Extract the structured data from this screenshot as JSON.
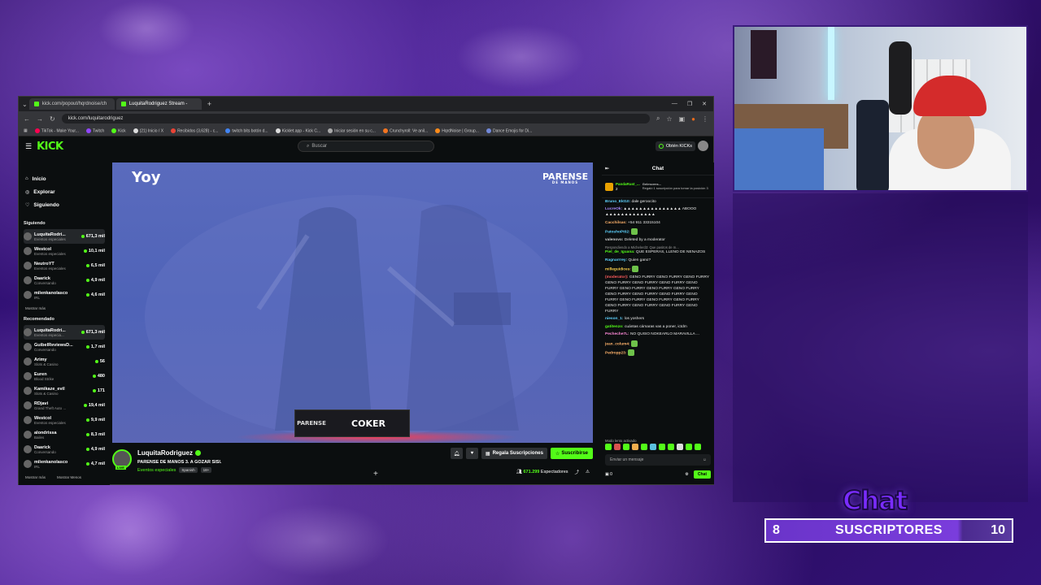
{
  "browser": {
    "tabs": [
      {
        "label": "kick.com/popout/hqrdnoise/ch"
      },
      {
        "label": "LuquitaRodriguez Stream -"
      }
    ],
    "url": "kick.com/luquitarodriguez",
    "bookmarks": [
      "TikTok - Make Your...",
      "Twitch",
      "Kick",
      "(21) Inicio / X",
      "Recibidos (3,628) - c...",
      "twitch bits botón d...",
      "Kicklet.app - Kick C...",
      "Iniciar sesión en su c...",
      "Crunchyroll: Ve anil...",
      "HqrdNoise | Group...",
      "Dance Emojis for Di..."
    ]
  },
  "kick": {
    "logo": "KICK",
    "search_placeholder": "Buscar",
    "kicks_button": "Obtén KICKs",
    "nav": [
      {
        "icon": "home-icon",
        "label": "Inicio"
      },
      {
        "icon": "compass-icon",
        "label": "Explorar"
      },
      {
        "icon": "heart-icon",
        "label": "Siguiendo"
      }
    ],
    "following_title": "Siguiendo",
    "following": [
      {
        "name": "LuquitaRodri...",
        "category": "Eventos especiales",
        "viewers": "671,3 mil"
      },
      {
        "name": "Westcol",
        "category": "Eventos especiales",
        "viewers": "10,1 mil"
      },
      {
        "name": "NeutroYT",
        "category": "Eventos especiales",
        "viewers": "6,5 mil"
      },
      {
        "name": "Daarick",
        "category": "Conversando",
        "viewers": "4,9 mil"
      },
      {
        "name": "milenkanolasco",
        "category": "IRL",
        "viewers": "4,6 mil"
      }
    ],
    "show_more": "Mostrar más",
    "recommended_title": "Recomendado",
    "recommended": [
      {
        "name": "LuquitaRodri...",
        "category": "Eventos especia...",
        "viewers": "671,3 mil"
      },
      {
        "name": "GuibelReviewsD...",
        "category": "Conversando",
        "viewers": "1,7 mil"
      },
      {
        "name": "Arimy",
        "category": "Slots & Casino",
        "viewers": "56"
      },
      {
        "name": "Euren",
        "category": "Blood Strike",
        "viewers": "480"
      },
      {
        "name": "Kamikaze_evil",
        "category": "Slots & Casino",
        "viewers": "171"
      },
      {
        "name": "RDjavi",
        "category": "Grand Theft Auto ...",
        "viewers": "19,4 mil"
      },
      {
        "name": "Westcol",
        "category": "Eventos especiales",
        "viewers": "9,9 mil"
      },
      {
        "name": "alondrissa",
        "category": "Bailes",
        "viewers": "8,3 mil"
      },
      {
        "name": "Daarick",
        "category": "Conversando",
        "viewers": "4,9 mil"
      },
      {
        "name": "milenkanolasco",
        "category": "IRL",
        "viewers": "4,7 mil"
      }
    ],
    "show_more_2": "Mostrar más",
    "show_less": "Mostrar Menos"
  },
  "player": {
    "watermark": "Yoy",
    "event_logo": "PARENSE",
    "event_logo_sub": "DE MANOS",
    "lower_third_logo": "PARENSE",
    "lower_third_name": "COKER"
  },
  "stream": {
    "name": "LuquitaRodriguez",
    "title": "PARENSE DE MANOS 3. A GOZAR SISI.",
    "category": "Eventos especiales",
    "tags": [
      "Spanish",
      "18+"
    ],
    "live_badge": "LIVE",
    "gift_button": "Regala Suscripciones",
    "subscribe_button": "Suscribirse",
    "viewer_count": "671.299",
    "viewer_label": "Espectadores"
  },
  "chat": {
    "title": "Chat",
    "pinned_user": "PandaRust_...",
    "pinned_count": "2",
    "pinned_gifter": "Gelescens...",
    "pinned_gift_text": "Regaló 1 suscripción para tomar la posición 3",
    "messages": [
      {
        "user": "Bruno_Ekt10:",
        "color": "#5fd3ff",
        "text": "dale geroocito"
      },
      {
        "user": "LucreOk:",
        "color": "#a98bff",
        "text": "▲▲▲▲▲▲▲▲▲▲▲▲▲▲▲ ABOOO ▲▲▲▲▲▲▲▲▲▲▲▲▲"
      },
      {
        "user": "Cacchilsas:",
        "color": "#ffb36b",
        "text": "+54 911 33315104"
      },
      {
        "user": "PatoshoPt02:",
        "color": "#5fd3ff",
        "text": ""
      },
      {
        "user": "valenovo:",
        "color": "#cfcfcf",
        "text": "Deleted by a moderator"
      },
      {
        "user": "Piel_de_Iguana:",
        "color": "#53fc18",
        "text": "QUE ESPERAS, LLENO DE NENAZOS",
        "reply": "Respondiendo a Michelerd3: Que pasitos de m..."
      },
      {
        "user": "Ragnarrrey:",
        "color": "#5fd3ff",
        "text": "Quien gano?"
      },
      {
        "user": "milleguidices:",
        "color": "#ffd24d",
        "text": ""
      },
      {
        "user": "(moderator):",
        "color": "#ff5c5c",
        "text": "GENO FURRY GENO FURRY GENO FURRY GENO FURRY GENO FURRY GENO FURRY GENO FURRY GENO FURRY GENO FURRY GENO FURRY GENO FURRY GENO FURRY GENO FURRY GENO FURRY GENO FURRY GENO FURRY GENO FURRY GENO FURRY GENO FURRY GENO FURRY GENO FURRY"
      },
      {
        "user": "nieson_1:",
        "color": "#5fd3ff",
        "text": "los yoshers"
      },
      {
        "user": "gatitenzo:",
        "color": "#53fc18",
        "text": "cuántas cámaras vas a poner, ictdm"
      },
      {
        "user": "Pecheche7L:",
        "color": "#ff8ad8",
        "text": "NO QUISO NOKEARLO MARAVILLA ..."
      },
      {
        "user": "jean_colum4:",
        "color": "#ffb36b",
        "text": ""
      },
      {
        "user": "Pedropp23:",
        "color": "#ffb36b",
        "text": ""
      }
    ],
    "mod_mode": "Modo lento activado",
    "input_placeholder": "Enviar un mensaje",
    "kicks_count": "0",
    "send_button": "Chat"
  },
  "overlay": {
    "chat_label": "Chat",
    "subs_current": "8",
    "subs_label": "SUSCRIPTORES",
    "subs_goal": "10",
    "subs_progress": 0.8
  },
  "colors": {
    "kick_green": "#53fc18",
    "overlay_purple": "#7a2cff",
    "background_purple": "#2a0d63"
  }
}
